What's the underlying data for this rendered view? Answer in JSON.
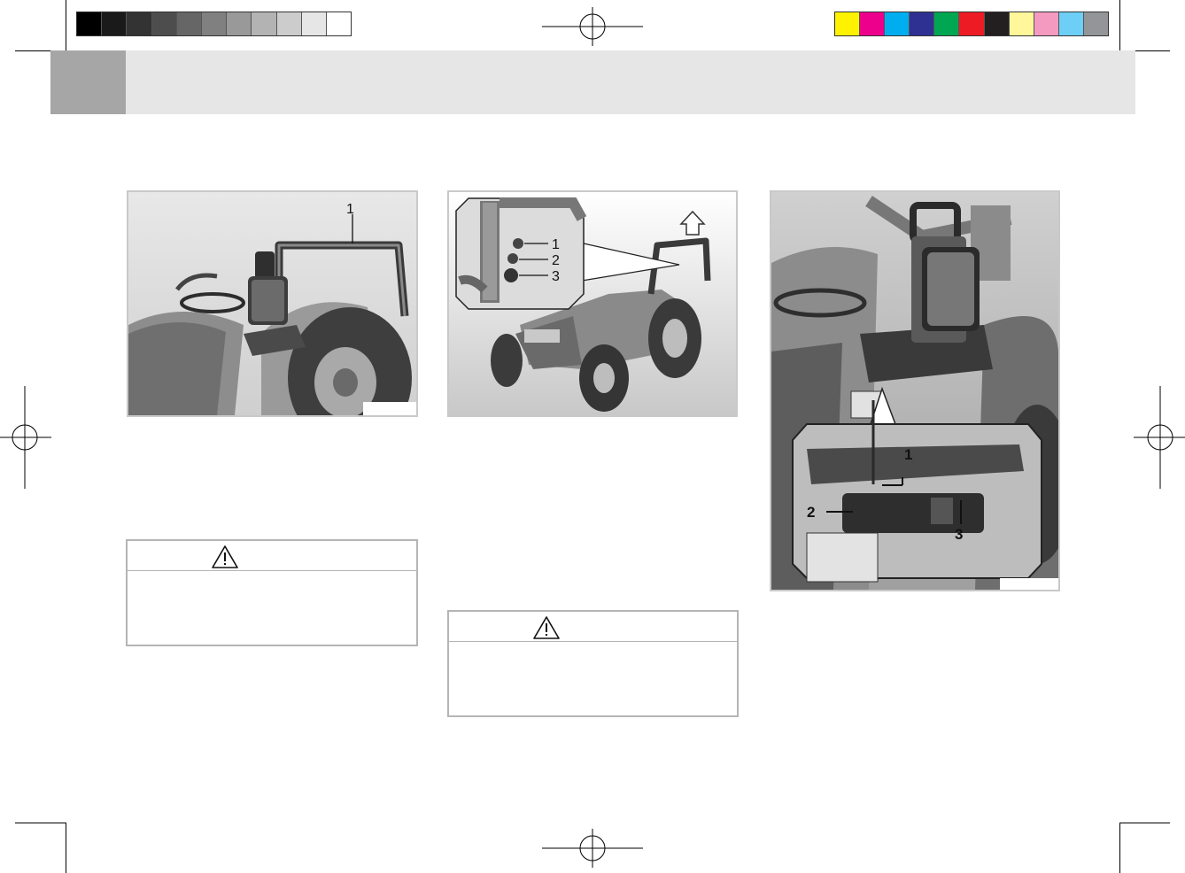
{
  "color_bar_left": {
    "swatches": [
      "#000000",
      "#1a1a1a",
      "#333333",
      "#4d4d4d",
      "#666666",
      "#808080",
      "#999999",
      "#b3b3b3",
      "#cccccc",
      "#e6e6e6",
      "#ffffff"
    ]
  },
  "color_bar_right": {
    "swatches": [
      "#fff200",
      "#ec008c",
      "#00aeef",
      "#2e3192",
      "#00a651",
      "#ed1c24",
      "#231f20",
      "#fff799",
      "#f49ac1",
      "#6dcff6",
      "#939598"
    ]
  },
  "header": {
    "accent": "#a6a6a6",
    "band": "#e6e6e6",
    "title": ""
  },
  "figure1": {
    "callouts": [
      "1"
    ]
  },
  "figure2": {
    "callouts": [
      "1",
      "2",
      "3"
    ]
  },
  "figure3": {
    "callouts": [
      "1",
      "2",
      "3"
    ]
  },
  "warning1": {
    "icon": "warning-triangle-icon",
    "title": "",
    "body": ""
  },
  "warning2": {
    "icon": "warning-triangle-icon",
    "title": "",
    "body": ""
  }
}
